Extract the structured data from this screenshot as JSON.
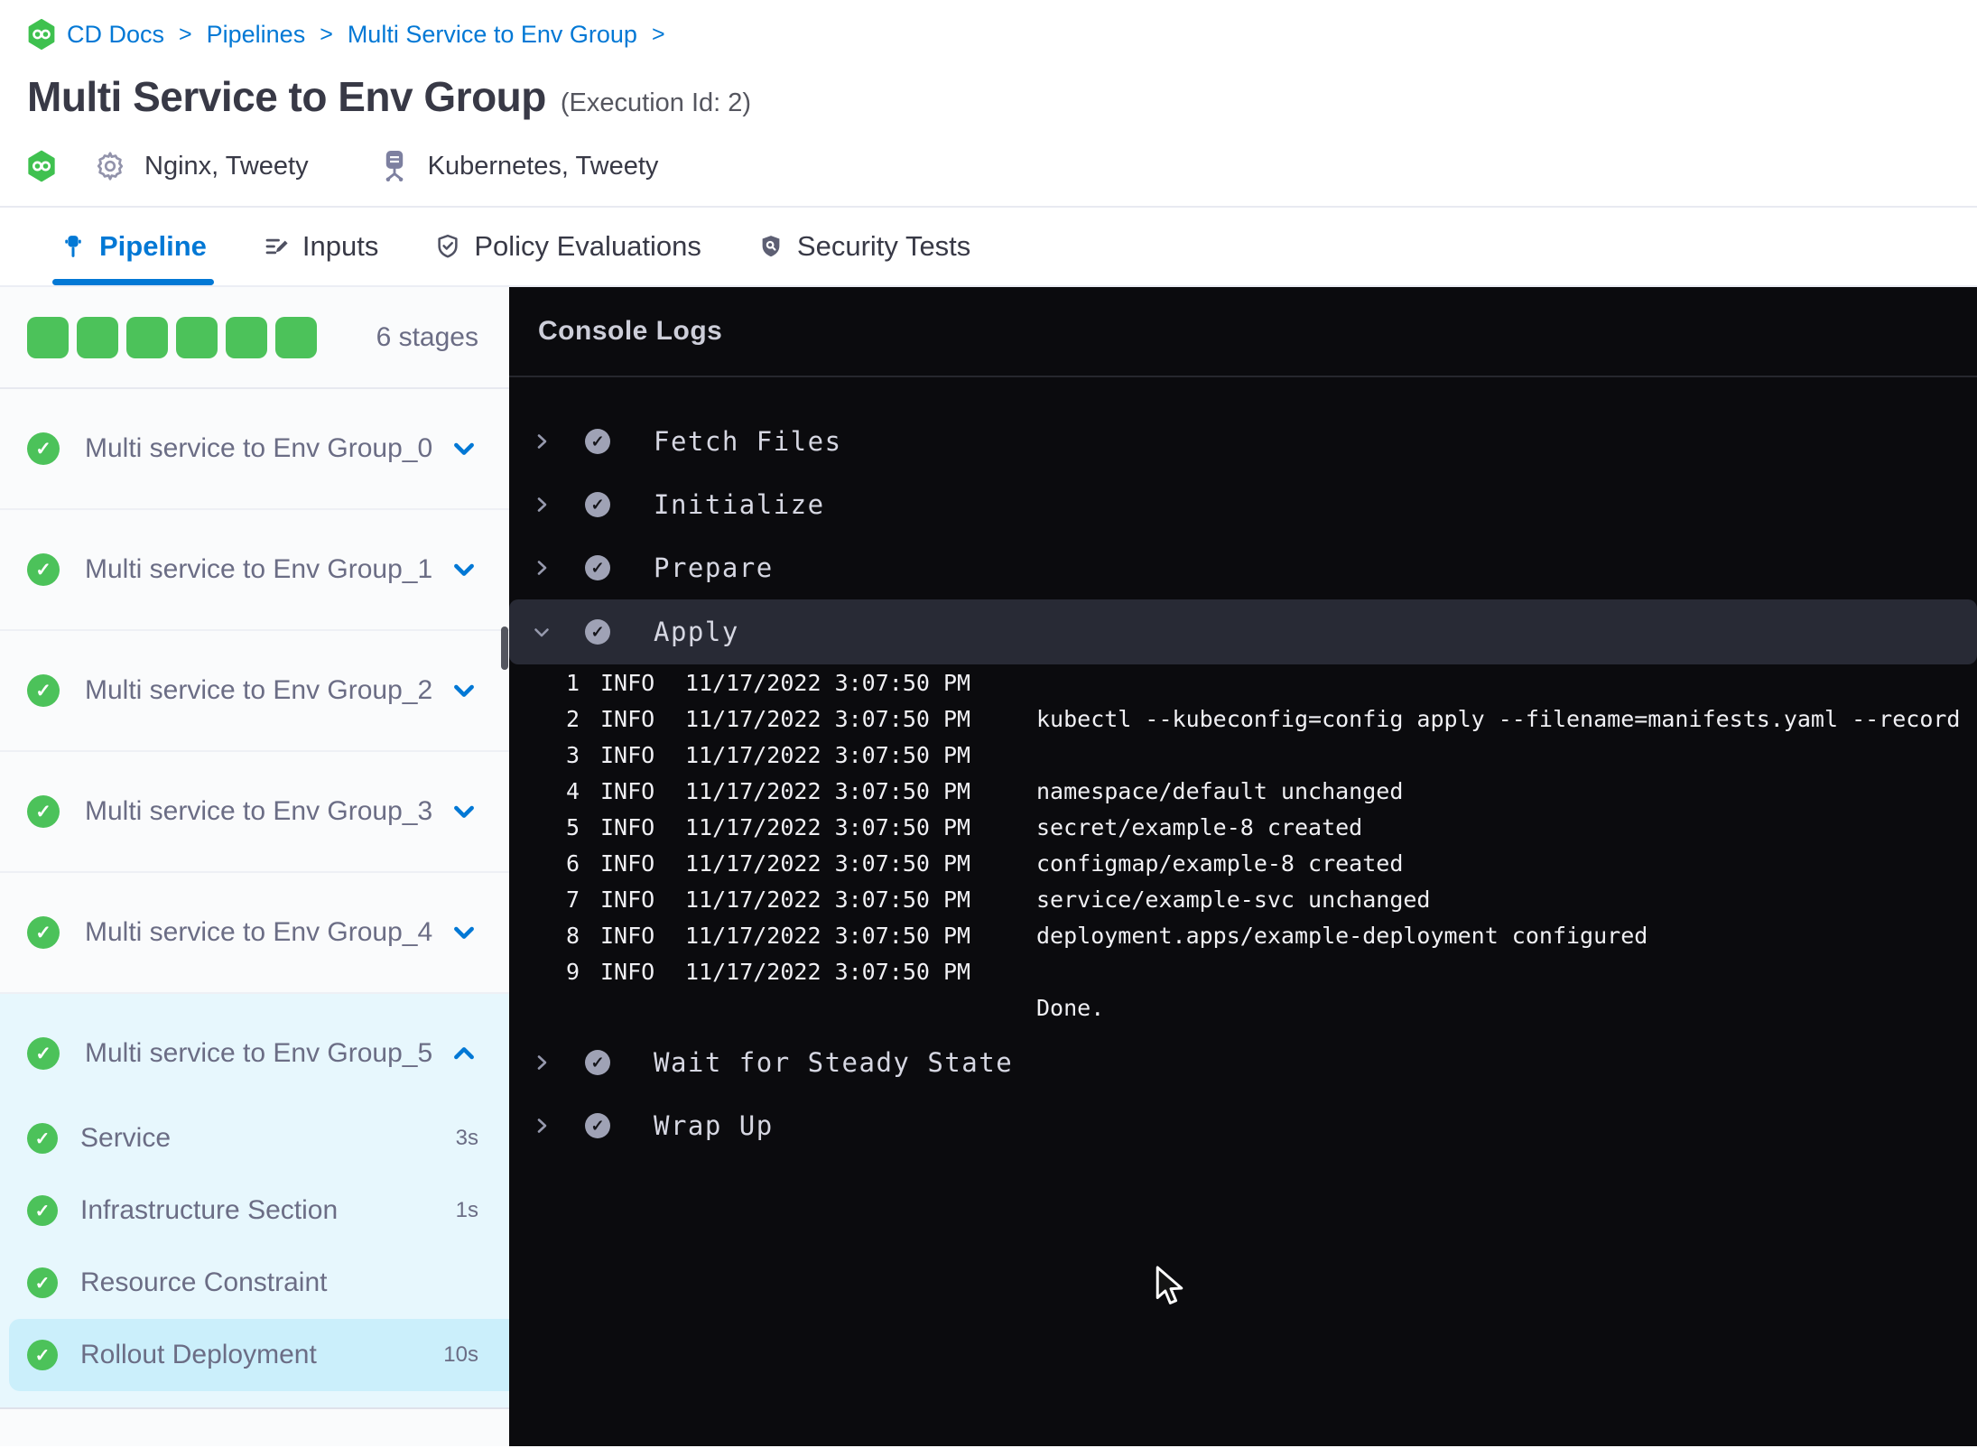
{
  "breadcrumb": {
    "separator": ">",
    "items": [
      "CD Docs",
      "Pipelines",
      "Multi Service to Env Group"
    ]
  },
  "header": {
    "title": "Multi Service to Env Group",
    "execution_id": "(Execution Id: 2)",
    "services_label": "Nginx, Tweety",
    "environments_label": "Kubernetes, Tweety"
  },
  "tabs": [
    {
      "label": "Pipeline",
      "active": true
    },
    {
      "label": "Inputs",
      "active": false
    },
    {
      "label": "Policy Evaluations",
      "active": false
    },
    {
      "label": "Security Tests",
      "active": false
    }
  ],
  "sidebar": {
    "stage_count_label": "6 stages",
    "stage_squares": 6,
    "stages": [
      {
        "name": "Multi service to Env Group_0",
        "status": "success",
        "expanded": false
      },
      {
        "name": "Multi service to Env Group_1",
        "status": "success",
        "expanded": false
      },
      {
        "name": "Multi service to Env Group_2",
        "status": "success",
        "expanded": false
      },
      {
        "name": "Multi service to Env Group_3",
        "status": "success",
        "expanded": false
      },
      {
        "name": "Multi service to Env Group_4",
        "status": "success",
        "expanded": false
      },
      {
        "name": "Multi service to Env Group_5",
        "status": "success",
        "expanded": true,
        "steps": [
          {
            "label": "Service",
            "duration": "3s",
            "status": "success",
            "selected": false
          },
          {
            "label": "Infrastructure Section",
            "duration": "1s",
            "status": "success",
            "selected": false
          },
          {
            "label": "Resource Constraint",
            "duration": "",
            "status": "success",
            "selected": false
          },
          {
            "label": "Rollout Deployment",
            "duration": "10s",
            "status": "success",
            "selected": true
          }
        ]
      }
    ]
  },
  "console": {
    "title": "Console Logs",
    "steps": [
      {
        "label": "Fetch Files",
        "status": "success",
        "expanded": false
      },
      {
        "label": "Initialize",
        "status": "success",
        "expanded": false
      },
      {
        "label": "Prepare",
        "status": "success",
        "expanded": false
      },
      {
        "label": "Apply",
        "status": "success",
        "expanded": true,
        "logs": [
          {
            "n": "1",
            "level": "INFO",
            "time": "11/17/2022 3:07:50 PM",
            "message": ""
          },
          {
            "n": "2",
            "level": "INFO",
            "time": "11/17/2022 3:07:50 PM",
            "message": "kubectl --kubeconfig=config apply --filename=manifests.yaml --record"
          },
          {
            "n": "3",
            "level": "INFO",
            "time": "11/17/2022 3:07:50 PM",
            "message": ""
          },
          {
            "n": "4",
            "level": "INFO",
            "time": "11/17/2022 3:07:50 PM",
            "message": "namespace/default unchanged"
          },
          {
            "n": "5",
            "level": "INFO",
            "time": "11/17/2022 3:07:50 PM",
            "message": "secret/example-8 created"
          },
          {
            "n": "6",
            "level": "INFO",
            "time": "11/17/2022 3:07:50 PM",
            "message": "configmap/example-8 created"
          },
          {
            "n": "7",
            "level": "INFO",
            "time": "11/17/2022 3:07:50 PM",
            "message": "service/example-svc unchanged"
          },
          {
            "n": "8",
            "level": "INFO",
            "time": "11/17/2022 3:07:50 PM",
            "message": "deployment.apps/example-deployment configured"
          },
          {
            "n": "9",
            "level": "INFO",
            "time": "11/17/2022 3:07:50 PM",
            "message": ""
          }
        ],
        "tail_message": "Done."
      },
      {
        "label": "Wait for Steady State",
        "status": "success",
        "expanded": false
      },
      {
        "label": "Wrap Up",
        "status": "success",
        "expanded": false
      }
    ]
  },
  "colors": {
    "accent_blue": "#0278d5",
    "success_green": "#4cc25a",
    "expanded_stage_bg": "#e7f7fd",
    "selected_step_bg": "#cbeffb",
    "console_bg": "#0b0b0e",
    "console_row_highlight": "#282a35"
  }
}
